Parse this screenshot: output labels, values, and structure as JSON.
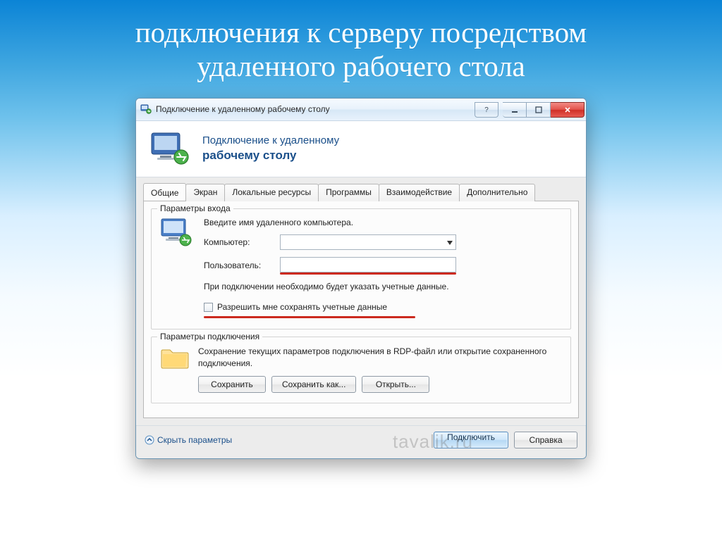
{
  "slide": {
    "title_l1": "подключения к серверу посредством",
    "title_l2": "удаленного рабочего стола"
  },
  "titlebar": {
    "title": "Подключение к удаленному рабочему столу"
  },
  "banner": {
    "line1": "Подключение к удаленному",
    "line2": "рабочему столу"
  },
  "tabs": [
    "Общие",
    "Экран",
    "Локальные ресурсы",
    "Программы",
    "Взаимодействие",
    "Дополнительно"
  ],
  "login_group": {
    "legend": "Параметры входа",
    "intro": "Введите имя удаленного компьютера.",
    "computer_label": "Компьютер:",
    "computer_value": "",
    "user_label": "Пользователь:",
    "user_value": "",
    "hint": "При подключении необходимо будет указать учетные данные.",
    "allow_save_label": "Разрешить мне сохранять учетные данные"
  },
  "conn_group": {
    "legend": "Параметры подключения",
    "text": "Сохранение текущих параметров подключения в RDP-файл или открытие сохраненного подключения.",
    "save": "Сохранить",
    "save_as": "Сохранить как...",
    "open": "Открыть..."
  },
  "footer": {
    "hide_params": "Скрыть параметры",
    "connect": "Подключить",
    "help": "Справка"
  },
  "watermark": "tavalik.ru"
}
